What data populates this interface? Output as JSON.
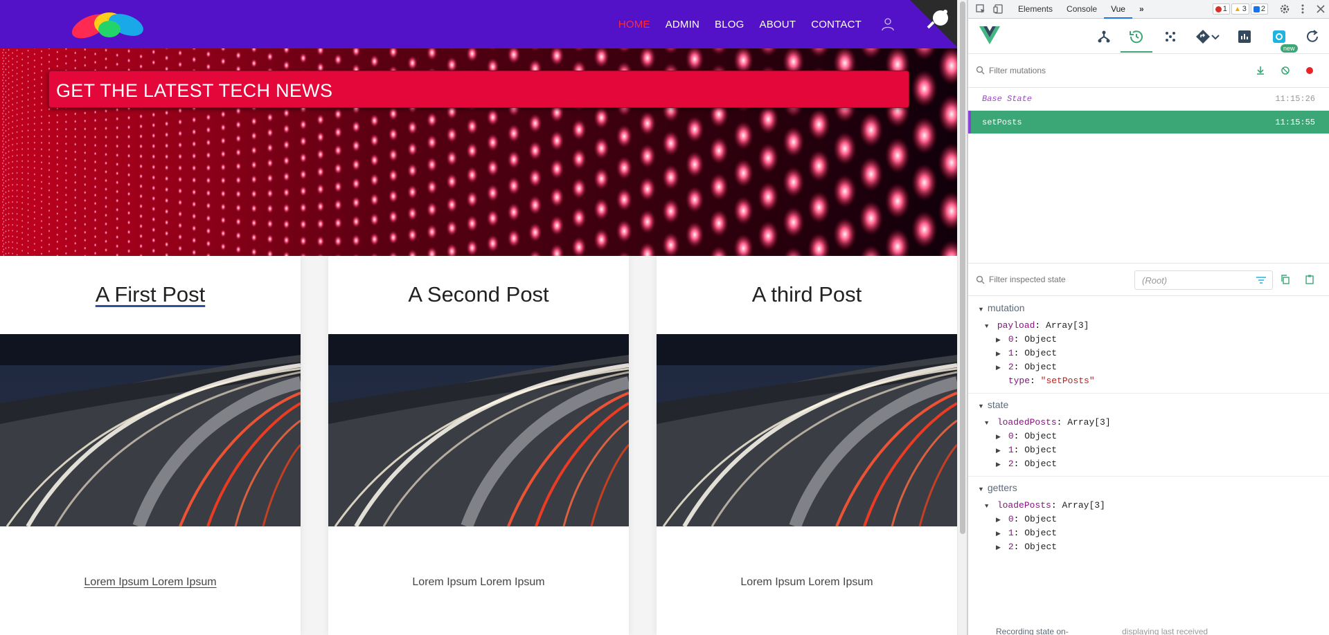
{
  "site": {
    "nav": {
      "links": [
        {
          "label": "HOME",
          "active": true
        },
        {
          "label": "ADMIN",
          "active": false
        },
        {
          "label": "BLOG",
          "active": false
        },
        {
          "label": "ABOUT",
          "active": false
        },
        {
          "label": "CONTACT",
          "active": false
        }
      ]
    },
    "hero": {
      "title": "GET THE LATEST TECH NEWS"
    },
    "posts": [
      {
        "title": "A First Post",
        "text": "Lorem Ipsum Lorem Ipsum"
      },
      {
        "title": "A Second Post",
        "text": "Lorem Ipsum Lorem Ipsum"
      },
      {
        "title": "A third Post",
        "text": "Lorem Ipsum Lorem Ipsum"
      }
    ]
  },
  "devtools": {
    "tabs": [
      "Elements",
      "Console",
      "Vue"
    ],
    "active_tab": "Vue",
    "badges": {
      "errors": "1",
      "warnings": "3",
      "messages": "2"
    },
    "new_badge": "new",
    "mutations_filter_placeholder": "Filter mutations",
    "mutations": [
      {
        "name": "Base State",
        "time": "11:15:26"
      },
      {
        "name": "setPosts",
        "time": "11:15:55"
      }
    ],
    "state_filter_placeholder": "Filter inspected state",
    "root_select": "(Root)",
    "tree": {
      "mutation": {
        "head": "mutation",
        "payload_key": "payload",
        "payload_val": "Array[3]",
        "items": [
          "0",
          "1",
          "2"
        ],
        "item_val": "Object",
        "type_key": "type",
        "type_val": "\"setPosts\""
      },
      "state": {
        "head": "state",
        "key": "loadedPosts",
        "val": "Array[3]",
        "items": [
          "0",
          "1",
          "2"
        ],
        "item_val": "Object"
      },
      "getters": {
        "head": "getters",
        "key": "loadePosts",
        "val": "Array[3]",
        "items": [
          "0",
          "1",
          "2"
        ],
        "item_val": "Object"
      }
    },
    "footer_left": "Recording state on-",
    "footer_right": "displaying last received"
  },
  "colors": {
    "navbar": "#5312c7",
    "nav_active": "#ff2a3a",
    "hero_banner": "#e3073a",
    "vue_green": "#3ba776",
    "mutation_key": "#881280",
    "string": "#c41a16"
  }
}
